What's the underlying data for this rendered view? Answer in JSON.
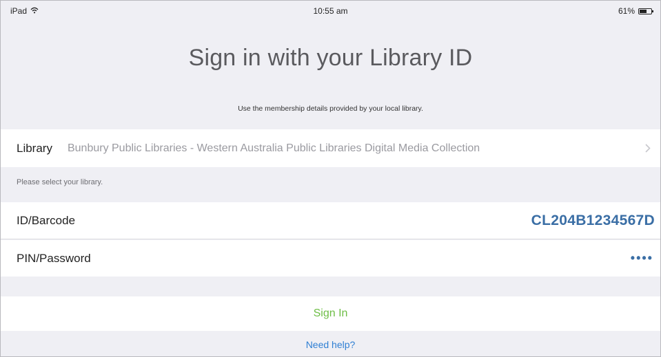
{
  "status_bar": {
    "device": "iPad",
    "time": "10:55 am",
    "battery": "61%",
    "battery_level": 0.61,
    "wifi_icon": "wifi-icon",
    "battery_icon": "battery-icon"
  },
  "header": {
    "title": "Sign in with your Library ID",
    "subtitle": "Use the membership details provided by your local library."
  },
  "library": {
    "label": "Library",
    "value": "Bunbury Public Libraries - Western Australia Public Libraries Digital Media Collection",
    "chevron_icon": "chevron-right-icon",
    "hint": "Please select your library."
  },
  "form": {
    "id_label": "ID/Barcode",
    "id_value": "CL204B1234567D",
    "pin_label": "PIN/Password",
    "pin_value": "••••"
  },
  "actions": {
    "sign_in": "Sign In",
    "help": "Need help?"
  },
  "colors": {
    "background": "#efeff4",
    "value_blue": "#3a6ea5",
    "sign_in_green": "#6dbd45",
    "link_blue": "#2f7fd3"
  }
}
